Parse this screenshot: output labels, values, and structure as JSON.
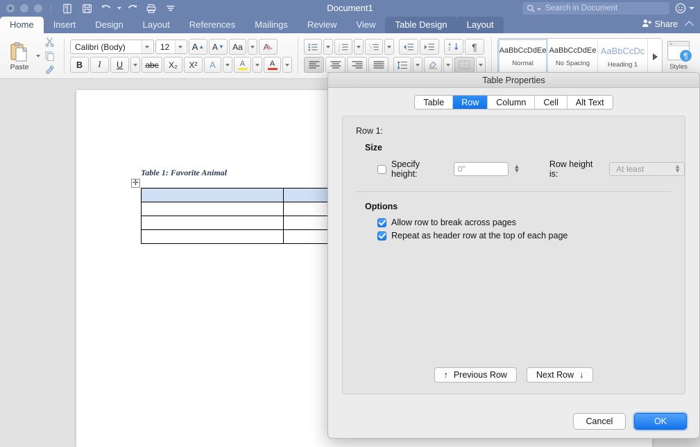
{
  "titlebar": {
    "document_title": "Document1",
    "quick_access": [
      {
        "name": "new-document-icon",
        "label": "New"
      },
      {
        "name": "save-icon",
        "label": "Save"
      },
      {
        "name": "undo-icon",
        "label": "Undo"
      },
      {
        "name": "redo-icon",
        "label": "Redo"
      },
      {
        "name": "print-icon",
        "label": "Print"
      },
      {
        "name": "customize-toolbar-icon",
        "label": "Customize"
      }
    ],
    "search_placeholder": "Search in Document"
  },
  "ribbon_tabs": {
    "tabs": [
      "Home",
      "Insert",
      "Design",
      "Layout",
      "References",
      "Mailings",
      "Review",
      "View"
    ],
    "contextual": [
      "Table Design",
      "Layout"
    ],
    "active": "Home",
    "share_label": "Share"
  },
  "ribbon": {
    "paste_label": "Paste",
    "font_name": "Calibri (Body)",
    "font_size": "12",
    "grow_font": "A",
    "shrink_font": "A",
    "change_case": "Aa",
    "clear_formatting": "A",
    "bold": "B",
    "italic": "I",
    "underline": "U",
    "strikethrough": "abc",
    "subscript": "X₂",
    "superscript": "X²",
    "text_effects": "A",
    "highlight": "A",
    "font_color": "A",
    "styles": [
      {
        "preview": "AaBbCcDdEe",
        "name": "Normal"
      },
      {
        "preview": "AaBbCcDdEe",
        "name": "No Spacing"
      },
      {
        "preview": "AaBbCcDc",
        "name": "Heading 1"
      }
    ],
    "styles_pane_label": "Styles",
    "pilcrow": "¶"
  },
  "document": {
    "table_caption": "Table 1: Favorite Animal",
    "table_rows": 4,
    "table_columns": 2,
    "header_row_selected": true,
    "selection_color": "#cfe0f5"
  },
  "dialog": {
    "title": "Table Properties",
    "tabs": [
      "Table",
      "Row",
      "Column",
      "Cell",
      "Alt Text"
    ],
    "active_tab": "Row",
    "row_label": "Row 1:",
    "size_heading": "Size",
    "specify_height_label": "Specify height:",
    "specify_height_checked": false,
    "height_value": "0\"",
    "row_height_is_label": "Row height is:",
    "row_height_is_value": "At least",
    "options_heading": "Options",
    "options": [
      {
        "label": "Allow row to break across pages",
        "checked": true
      },
      {
        "label": "Repeat as header row at the top of each page",
        "checked": true
      }
    ],
    "previous_row_label": "Previous Row",
    "previous_row_arrow": "↑",
    "next_row_label": "Next Row",
    "next_row_arrow": "↓",
    "cancel_label": "Cancel",
    "ok_label": "OK",
    "accent_color": "#1d7df0"
  }
}
